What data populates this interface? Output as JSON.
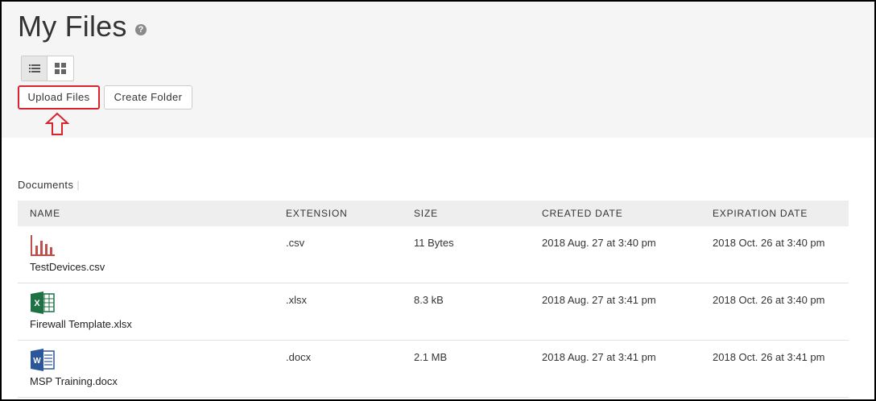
{
  "page": {
    "title": "My Files",
    "help_icon": "question-circle-icon"
  },
  "view_toggle": {
    "list_icon": "list-view-icon",
    "grid_icon": "grid-view-icon",
    "active": "list"
  },
  "toolbar": {
    "upload_label": "Upload Files",
    "create_folder_label": "Create Folder"
  },
  "annotation": {
    "arrow_icon": "up-arrow-outline-icon",
    "color": "#d9232e"
  },
  "section": {
    "label": "Documents"
  },
  "table": {
    "headers": [
      "NAME",
      "EXTENSION",
      "SIZE",
      "CREATED DATE",
      "EXPIRATION DATE"
    ],
    "rows": [
      {
        "icon": "bar-chart-icon",
        "name": "TestDevices.csv",
        "extension": ".csv",
        "size": "11 Bytes",
        "created": "2018 Aug. 27 at 3:40 pm",
        "expires": "2018 Oct. 26 at 3:40 pm"
      },
      {
        "icon": "excel-icon",
        "name": "Firewall Template.xlsx",
        "extension": ".xlsx",
        "size": "8.3 kB",
        "created": "2018 Aug. 27 at 3:41 pm",
        "expires": "2018 Oct. 26 at 3:40 pm"
      },
      {
        "icon": "word-icon",
        "name": "MSP Training.docx",
        "extension": ".docx",
        "size": "2.1 MB",
        "created": "2018 Aug. 27 at 3:41 pm",
        "expires": "2018 Oct. 26 at 3:41 pm"
      }
    ]
  },
  "colors": {
    "header_bg": "#f5f5f5",
    "table_head_bg": "#eeeeee",
    "highlight_red": "#d9232e",
    "excel_green": "#1e7145",
    "word_blue": "#2b579a",
    "csv_red": "#c0504d"
  }
}
